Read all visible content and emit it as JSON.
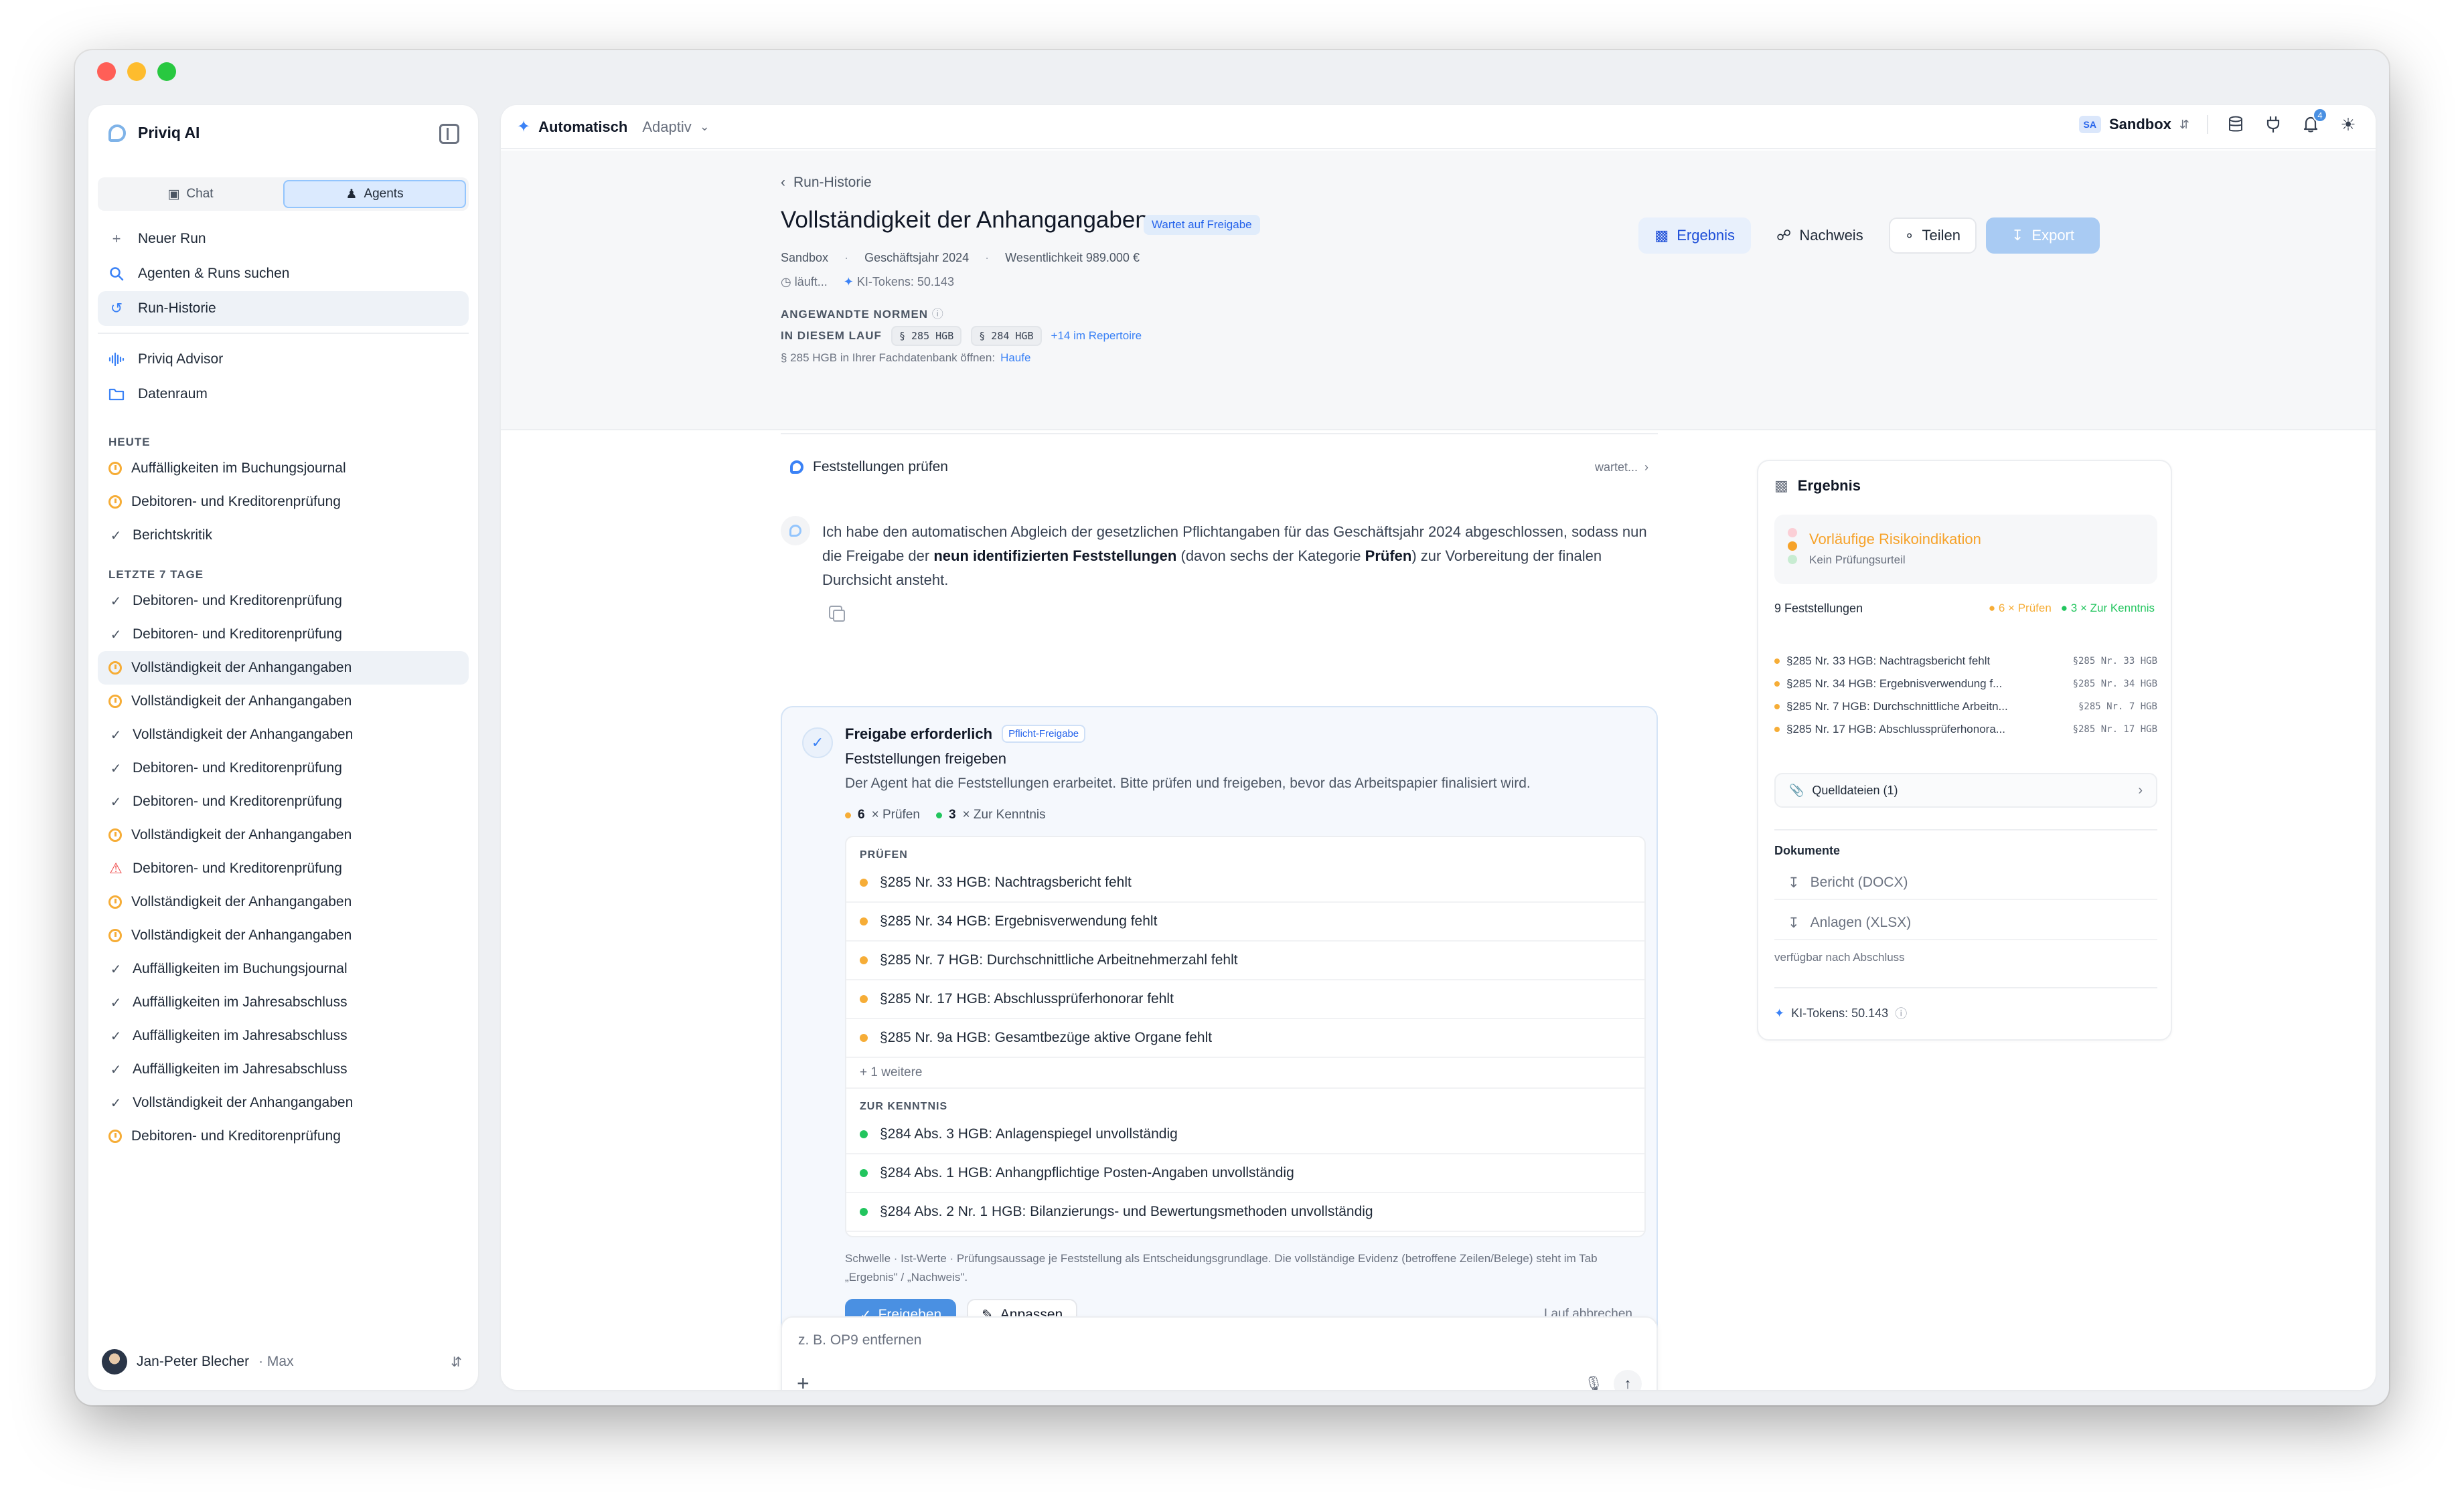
{
  "sidebar": {
    "brand": "Priviq AI",
    "tabs": [
      {
        "label": "Chat",
        "icon": "chat-icon",
        "active": false
      },
      {
        "label": "Agents",
        "icon": "agent-icon",
        "active": true
      }
    ],
    "nav": [
      {
        "label": "Neuer Run",
        "icon": "plus-icon"
      },
      {
        "label": "Agenten & Runs suchen",
        "icon": "search-icon"
      },
      {
        "label": "Run-Historie",
        "icon": "history-icon",
        "active": true
      }
    ],
    "nav2": [
      {
        "label": "Priviq Advisor",
        "icon": "waveform-icon"
      },
      {
        "label": "Datenraum",
        "icon": "folder-icon"
      }
    ],
    "today_label": "HEUTE",
    "today": [
      {
        "label": "Auffälligkeiten im Buchungsjournal",
        "status": "pending"
      },
      {
        "label": "Debitoren- und Kreditorenprüfung",
        "status": "pending"
      },
      {
        "label": "Berichtskritik",
        "status": "done"
      }
    ],
    "week_label": "LETZTE 7 TAGE",
    "week": [
      {
        "label": "Debitoren- und Kreditorenprüfung",
        "status": "done"
      },
      {
        "label": "Debitoren- und Kreditorenprüfung",
        "status": "done"
      },
      {
        "label": "Vollständigkeit der Anhangangaben",
        "status": "pending",
        "active": true
      },
      {
        "label": "Vollständigkeit der Anhangangaben",
        "status": "pending"
      },
      {
        "label": "Vollständigkeit der Anhangangaben",
        "status": "done"
      },
      {
        "label": "Debitoren- und Kreditorenprüfung",
        "status": "done"
      },
      {
        "label": "Debitoren- und Kreditorenprüfung",
        "status": "done"
      },
      {
        "label": "Vollständigkeit der Anhangangaben",
        "status": "pending"
      },
      {
        "label": "Debitoren- und Kreditorenprüfung",
        "status": "warning"
      },
      {
        "label": "Vollständigkeit der Anhangangaben",
        "status": "pending"
      },
      {
        "label": "Vollständigkeit der Anhangangaben",
        "status": "pending"
      },
      {
        "label": "Auffälligkeiten im Buchungsjournal",
        "status": "done"
      },
      {
        "label": "Auffälligkeiten im Jahresabschluss",
        "status": "done"
      },
      {
        "label": "Auffälligkeiten im Jahresabschluss",
        "status": "done"
      },
      {
        "label": "Auffälligkeiten im Jahresabschluss",
        "status": "done"
      },
      {
        "label": "Vollständigkeit der Anhangangaben",
        "status": "done"
      },
      {
        "label": "Debitoren- und Kreditorenprüfung",
        "status": "pending"
      }
    ],
    "user": {
      "name": "Jan-Peter Blecher",
      "plan": "· Max"
    }
  },
  "topbar": {
    "mode": "Automatisch",
    "mode_sub": "Adaptiv",
    "workspace_badge": "SA",
    "workspace": "Sandbox",
    "notifications": "4"
  },
  "header": {
    "back": "Run-Historie",
    "title": "Vollständigkeit der Anhangangaben",
    "status": "Wartet auf Freigabe",
    "meta": [
      "Sandbox",
      "Geschäftsjahr 2024",
      "Wesentlichkeit 989.000 €"
    ],
    "running": "läuft...",
    "tokens": "KI-Tokens: 50.143",
    "norms_label": "ANGEWANDTE NORMEN",
    "in_run_label": "IN DIESEM LAUF",
    "norms": [
      "§ 285 HGB",
      "§ 284 HGB"
    ],
    "norms_more": "+14 im Repertoire",
    "fachdb_text": "§ 285 HGB in Ihrer Fachdatenbank öffnen:",
    "fachdb_link": "Haufe",
    "actions": {
      "result": "Ergebnis",
      "evidence": "Nachweis",
      "share": "Teilen",
      "export": "Export"
    }
  },
  "conversation": {
    "step": "Feststellungen prüfen",
    "step_status": "wartet...",
    "msg_pre": "Ich habe den automatischen Abgleich der gesetzlichen Pflichtangaben für das Geschäftsjahr 2024 abgeschlossen, sodass nun die Freigabe der ",
    "msg_bold1": "neun identifizierten Feststellungen",
    "msg_mid": " (davon sechs der Kategorie ",
    "msg_bold2": "Prüfen",
    "msg_post": ") zur Vorbereitung der finalen Durchsicht ansteht."
  },
  "approval": {
    "title": "Freigabe erforderlich",
    "badge": "Pflicht-Freigabe",
    "subtitle": "Feststellungen freigeben",
    "description": "Der Agent hat die Feststellungen erarbeitet. Bitte prüfen und freigeben, bevor das Arbeitspapier finalisiert wird.",
    "count_check": "6",
    "count_check_label": "× Prüfen",
    "count_info": "3",
    "count_info_label": "× Zur Kenntnis",
    "group_check": "PRÜFEN",
    "items_check": [
      "§285 Nr. 33 HGB: Nachtragsbericht fehlt",
      "§285 Nr. 34 HGB: Ergebnisverwendung fehlt",
      "§285 Nr. 7 HGB: Durchschnittliche Arbeitnehmerzahl fehlt",
      "§285 Nr. 17 HGB: Abschlussprüferhonorar fehlt",
      "§285 Nr. 9a HGB: Gesamtbezüge aktive Organe fehlt"
    ],
    "more": "+ 1 weitere",
    "group_info": "ZUR KENNTNIS",
    "items_info": [
      "§284 Abs. 3 HGB: Anlagenspiegel unvollständig",
      "§284 Abs. 1 HGB: Anhangpflichtige Posten-Angaben unvollständig",
      "§284 Abs. 2 Nr. 1 HGB: Bilanzierungs- und Bewertungsmethoden unvollständig"
    ],
    "footnote": "Schwelle · Ist-Werte · Prüfungsaussage je Feststellung als Entscheidungsgrundlage. Die vollständige Evidenz (betroffene Zeilen/Belege) steht im Tab „Ergebnis\" / „Nachweis\".",
    "approve": "Freigeben",
    "adjust": "Anpassen",
    "abort": "Lauf abbrechen"
  },
  "composer": {
    "placeholder": "z. B. OP9 entfernen"
  },
  "result": {
    "title": "Ergebnis",
    "risk_title": "Vorläufige Risikoindikation",
    "risk_sub": "Kein Prüfungsurteil",
    "count": "9 Feststellungen",
    "count_check": "6 × Prüfen",
    "count_info": "3 × Zur Kenntnis",
    "items": [
      {
        "name": "§285 Nr. 33 HGB: Nachtragsbericht fehlt",
        "code": "§285 Nr. 33 HGB"
      },
      {
        "name": "§285 Nr. 34 HGB: Ergebnisverwendung f...",
        "code": "§285 Nr. 34 HGB"
      },
      {
        "name": "§285 Nr. 7 HGB: Durchschnittliche Arbeitn...",
        "code": "§285 Nr. 7 HGB"
      },
      {
        "name": "§285 Nr. 17 HGB: Abschlussprüferhonora...",
        "code": "§285 Nr. 17 HGB"
      }
    ],
    "sources": "Quelldateien (1)",
    "docs_label": "Dokumente",
    "doc_report": "Bericht (DOCX)",
    "doc_annex": "Anlagen (XLSX)",
    "doc_note": "verfügbar nach Abschluss",
    "tokens": "KI-Tokens: 50.143"
  },
  "colors": {
    "accent": "#4a90e2",
    "pending": "#f6ad37",
    "info": "#22c55e",
    "warning": "#ef4444"
  }
}
